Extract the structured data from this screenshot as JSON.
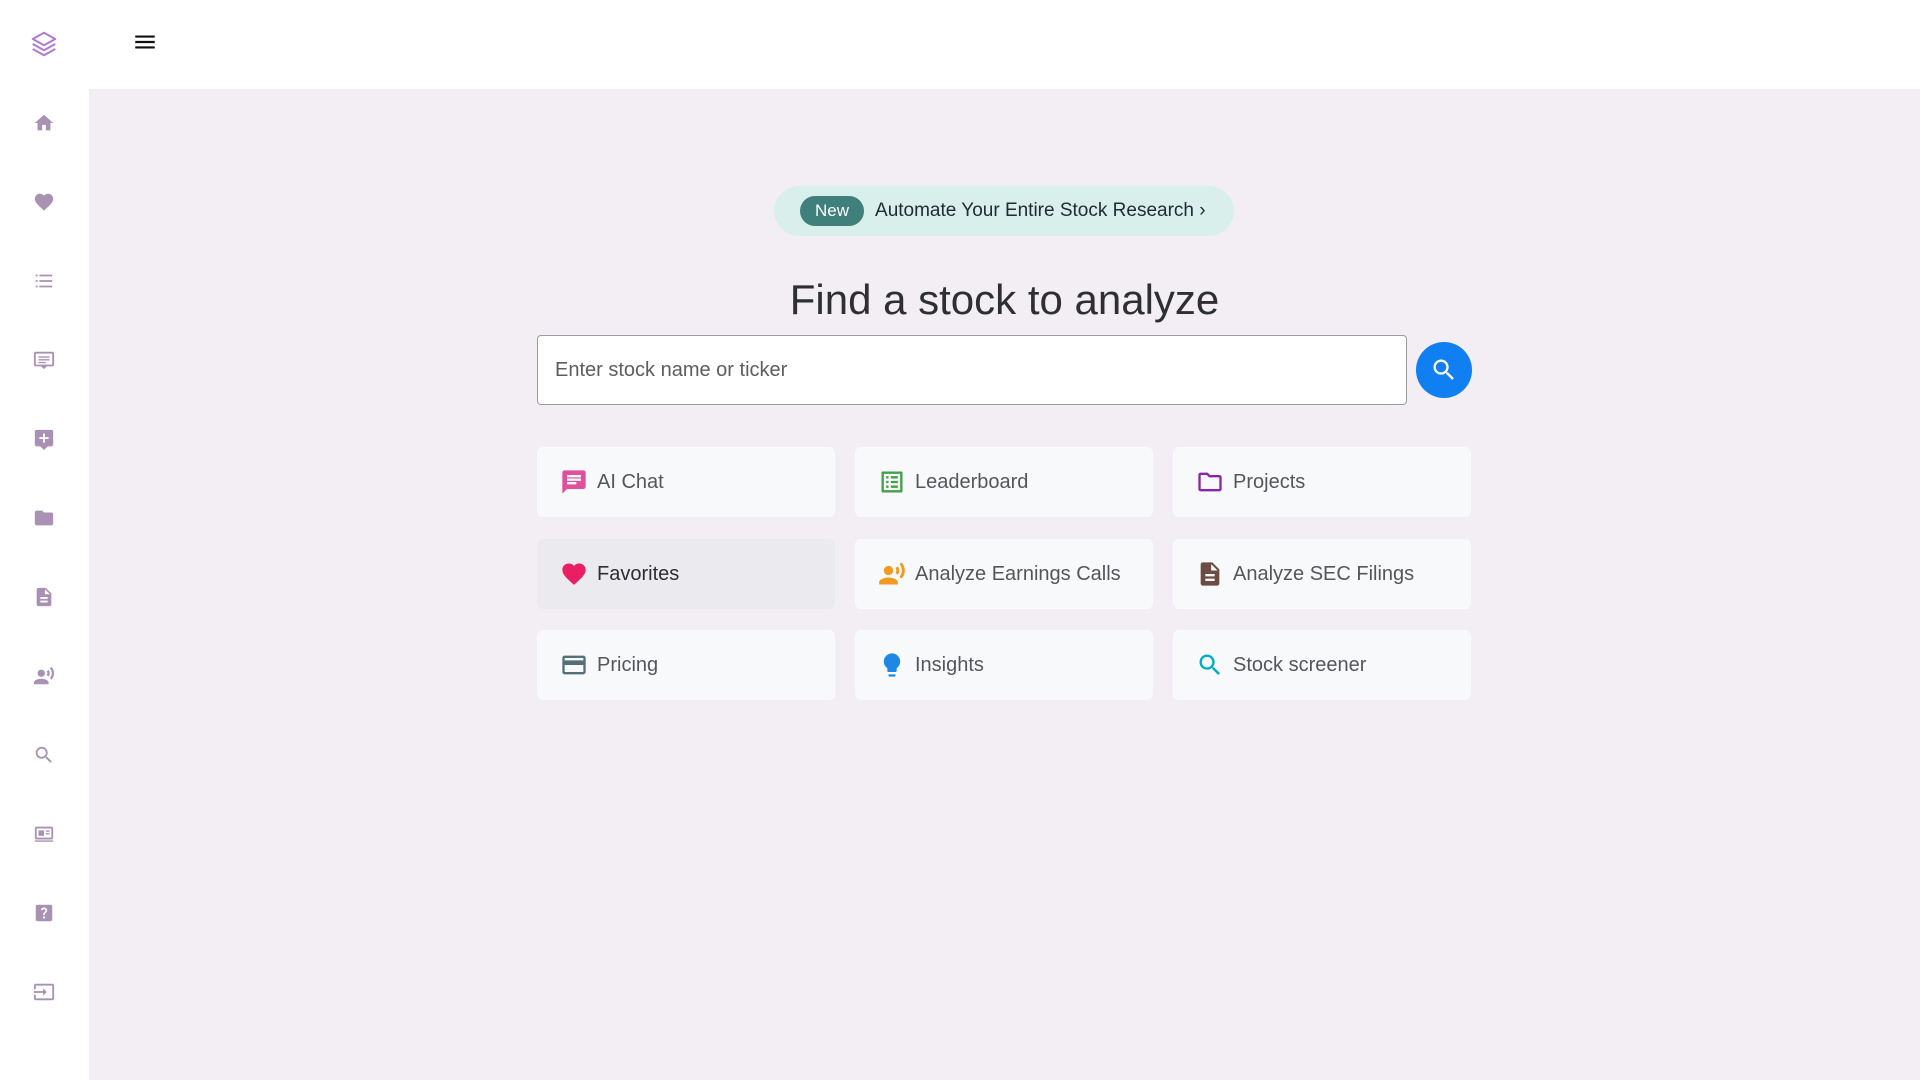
{
  "sidebar": {
    "items": [
      {
        "name": "home-icon"
      },
      {
        "name": "heart-icon"
      },
      {
        "name": "list-icon"
      },
      {
        "name": "chat-icon"
      },
      {
        "name": "add-comment-icon"
      },
      {
        "name": "folder-icon"
      },
      {
        "name": "document-icon"
      },
      {
        "name": "voice-icon"
      },
      {
        "name": "search-icon"
      },
      {
        "name": "news-icon"
      },
      {
        "name": "help-icon"
      },
      {
        "name": "login-icon"
      }
    ]
  },
  "promo": {
    "badge": "New",
    "text": "Automate Your Entire Stock Research ›"
  },
  "main": {
    "title": "Find a stock to analyze",
    "search_placeholder": "Enter stock name or ticker"
  },
  "tiles": [
    {
      "label": "AI Chat",
      "icon": "chat-icon",
      "color": "#e0509c"
    },
    {
      "label": "Leaderboard",
      "icon": "list-alt-icon",
      "color": "#43a047"
    },
    {
      "label": "Projects",
      "icon": "folder-outline-icon",
      "color": "#8e24aa"
    },
    {
      "label": "Favorites",
      "icon": "heart-icon",
      "color": "#e91e63"
    },
    {
      "label": "Analyze Earnings Calls",
      "icon": "voice-icon",
      "color": "#f29a1f"
    },
    {
      "label": "Analyze SEC Filings",
      "icon": "document-icon",
      "color": "#6d4c41"
    },
    {
      "label": "Pricing",
      "icon": "credit-card-icon",
      "color": "#546e7a"
    },
    {
      "label": "Insights",
      "icon": "lightbulb-icon",
      "color": "#1e88e5"
    },
    {
      "label": "Stock screener",
      "icon": "search-icon",
      "color": "#00acc1"
    }
  ],
  "colors": {
    "accent": "#0f7ff1",
    "sidebar_icon": "#a891b3",
    "background": "#f3eef4",
    "promo_bg": "#d9efec",
    "badge_bg": "#3f7f7c"
  }
}
